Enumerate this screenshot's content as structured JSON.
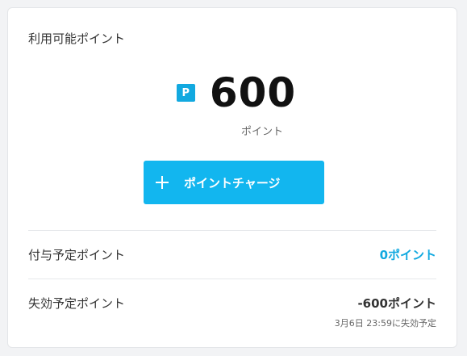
{
  "card": {
    "title": "利用可能ポイント",
    "point_badge": "P",
    "points": "600",
    "points_unit": "ポイント",
    "charge_button": "ポイントチャージ"
  },
  "scheduled_grant": {
    "label": "付与予定ポイント",
    "value": "0ポイント",
    "color": "#12a9e0"
  },
  "scheduled_expiry": {
    "label": "失効予定ポイント",
    "value": "-600ポイント",
    "note": "3月6日 23:59に失効予定"
  },
  "colors": {
    "accent": "#12b6ef",
    "badge": "#12a9e0"
  }
}
